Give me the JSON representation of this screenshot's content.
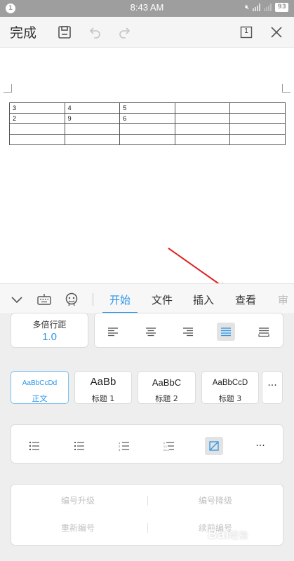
{
  "status_bar": {
    "notification_count": "1",
    "time": "8:43 AM",
    "battery": "93"
  },
  "toolbar": {
    "done_label": "完成",
    "page_count": "1"
  },
  "document": {
    "table": [
      [
        "3",
        "4",
        "5",
        "",
        ""
      ],
      [
        "2",
        "9",
        "6",
        "",
        ""
      ],
      [
        "",
        "",
        "",
        "",
        ""
      ],
      [
        "",
        "",
        "",
        "",
        ""
      ]
    ]
  },
  "ribbon": {
    "tabs": [
      {
        "label": "开始",
        "active": true
      },
      {
        "label": "文件",
        "active": false
      },
      {
        "label": "插入",
        "active": false
      },
      {
        "label": "查看",
        "active": false
      },
      {
        "label": "审",
        "active": false
      }
    ]
  },
  "panel": {
    "line_spacing": {
      "label": "多倍行距",
      "value": "1.0"
    },
    "alignments": [
      {
        "icon": "align-left-icon",
        "selected": false
      },
      {
        "icon": "align-center-icon",
        "selected": false
      },
      {
        "icon": "align-right-icon",
        "selected": false
      },
      {
        "icon": "align-justify-icon",
        "selected": true
      },
      {
        "icon": "align-distributed-icon",
        "selected": false
      }
    ],
    "styles": [
      {
        "sample": "AaBbCcDd",
        "name": "正文",
        "selected": true
      },
      {
        "sample": "AaBb",
        "name": "标题 1",
        "selected": false
      },
      {
        "sample": "AaBbC",
        "name": "标题 2",
        "selected": false
      },
      {
        "sample": "AaBbCcD",
        "name": "标题 3",
        "selected": false
      }
    ],
    "styles_more": "···",
    "lists": [
      {
        "icon": "bullet-list-icon",
        "selected": false
      },
      {
        "icon": "square-bullet-list-icon",
        "selected": false
      },
      {
        "icon": "numbered-list-icon",
        "selected": false
      },
      {
        "icon": "multilevel-list-icon",
        "selected": false
      },
      {
        "icon": "no-list-icon",
        "selected": true
      }
    ],
    "lists_more": "···",
    "numbering": {
      "promote": "编号升级",
      "demote": "编号降级",
      "restart": "重新编号",
      "continue": "续前编号"
    }
  },
  "colors": {
    "accent": "#2b95e9",
    "arrow": "#e02020",
    "status_bar": "#9e9e9e"
  },
  "watermark": {
    "text": "Bai",
    "suffix": "经验"
  }
}
